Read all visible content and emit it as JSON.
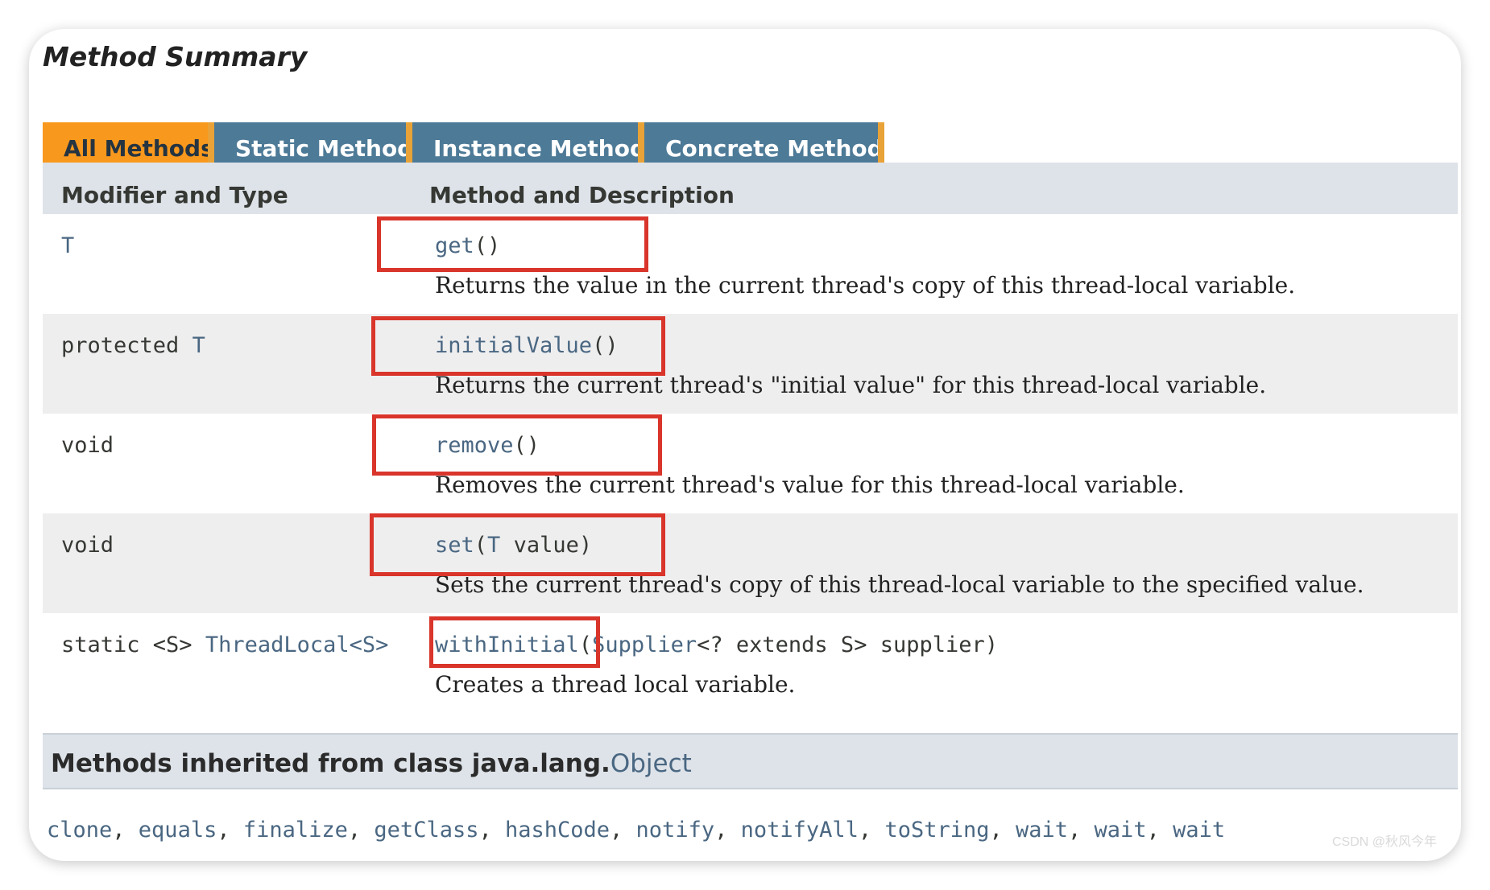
{
  "title": "Method Summary",
  "tabs": [
    {
      "label": "All Methods",
      "active": true
    },
    {
      "label": "Static Methods",
      "active": false
    },
    {
      "label": "Instance Methods",
      "active": false
    },
    {
      "label": "Concrete Methods",
      "active": false
    }
  ],
  "table": {
    "col_modifier": "Modifier and Type",
    "col_method": "Method and Description",
    "rows": [
      {
        "modifier_prefix": "",
        "modifier_link": "T",
        "method_name": "get",
        "method_params": "()",
        "description": "Returns the value in the current thread's copy of this thread-local variable."
      },
      {
        "modifier_prefix": "protected ",
        "modifier_link": "T",
        "method_name": "initialValue",
        "method_params": "()",
        "description": "Returns the current thread's \"initial value\" for this thread-local variable."
      },
      {
        "modifier_prefix": "void",
        "modifier_link": "",
        "method_name": "remove",
        "method_params": "()",
        "description": "Removes the current thread's value for this thread-local variable."
      },
      {
        "modifier_prefix": "void",
        "modifier_link": "",
        "method_name": "set",
        "method_params_open": "(",
        "method_params_link": "T",
        "method_params_rest": " value)",
        "description": "Sets the current thread's copy of this thread-local variable to the specified value."
      },
      {
        "modifier_prefix": "static <S> ",
        "modifier_link": "ThreadLocal<S>",
        "method_name": "withInitial",
        "method_params_open": "(",
        "method_params_link": "Supplier",
        "method_params_rest": "<? extends S> supplier)",
        "description": "Creates a thread local variable."
      }
    ]
  },
  "inherited": {
    "label": "Methods inherited from class java.lang.",
    "class_name": "Object",
    "methods": [
      "clone",
      "equals",
      "finalize",
      "getClass",
      "hashCode",
      "notify",
      "notifyAll",
      "toString",
      "wait",
      "wait",
      "wait"
    ]
  },
  "watermark": "CSDN @秋风今年",
  "colors": {
    "tab_active": "#f8981d",
    "tab_inactive": "#4d7a97",
    "header_bg": "#dee3e9",
    "link": "#4a6782",
    "highlight_box": "#d9352b"
  }
}
